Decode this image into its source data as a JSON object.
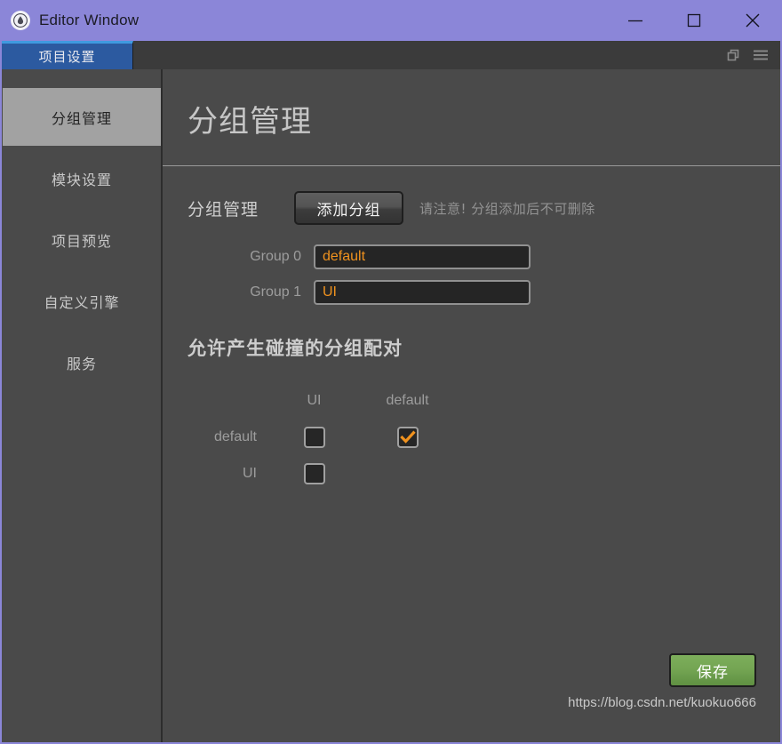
{
  "window": {
    "title": "Editor Window",
    "icon": "droplet-icon",
    "accent_color": "#8b86d8",
    "controls": [
      {
        "name": "minimize-button",
        "glyph": "minimize-icon"
      },
      {
        "name": "maximize-button",
        "glyph": "maximize-icon"
      },
      {
        "name": "close-button",
        "glyph": "close-icon"
      }
    ]
  },
  "tabbar": {
    "tabs": [
      {
        "label": "项目设置",
        "selected": true
      }
    ],
    "right_icons": [
      {
        "name": "restore-panel-icon"
      },
      {
        "name": "hamburger-menu-icon"
      }
    ],
    "active_tab_color": "#2c5aa0",
    "active_tab_top_color": "#3f9ae0"
  },
  "sidebar": {
    "items": [
      {
        "label": "分组管理",
        "selected": true
      },
      {
        "label": "模块设置",
        "selected": false
      },
      {
        "label": "项目预览",
        "selected": false
      },
      {
        "label": "自定义引擎",
        "selected": false
      },
      {
        "label": "服务",
        "selected": false
      }
    ]
  },
  "main": {
    "page_title": "分组管理",
    "group_section": {
      "label": "分组管理",
      "add_button_label": "添加分组",
      "note": "请注意! 分组添加后不可删除",
      "rows": [
        {
          "label": "Group 0",
          "value": "default"
        },
        {
          "label": "Group 1",
          "value": "UI"
        }
      ],
      "input_text_color": "#f0921e"
    },
    "matrix": {
      "title": "允许产生碰撞的分组配对",
      "columns": [
        "UI",
        "default"
      ],
      "rows": [
        {
          "label": "default",
          "cells": [
            false,
            true
          ]
        },
        {
          "label": "UI",
          "cells": [
            false
          ]
        }
      ],
      "check_color": "#f0921e"
    },
    "save_button_label": "保存",
    "save_button_color": "#73a452",
    "watermark": "https://blog.csdn.net/kuokuo666"
  }
}
